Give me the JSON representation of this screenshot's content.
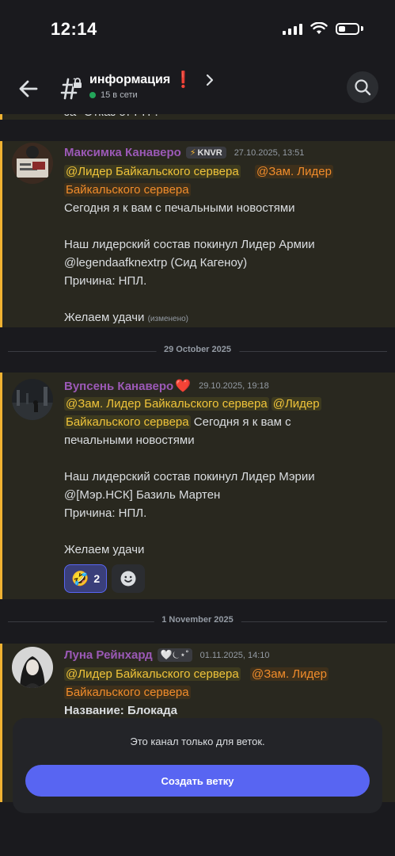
{
  "status": {
    "time": "12:14"
  },
  "header": {
    "channel_title": "информация",
    "title_emoji": "❗",
    "online": "15 в сети"
  },
  "messages": [
    {
      "author": "Максимка Канаверо",
      "tag": "KNVR",
      "timestamp": "27.10.2025, 13:51",
      "mention1": "@Лидер Байкальского сервера",
      "mention2a": "@Зам. Лидер",
      "mention2b": "Байкальского сервера",
      "line1": "Сегодня я к вам с печальными новостями",
      "line2": "Наш лидерский состав покинул Лидер Армии",
      "line3": "@legendaafknextrp (Сид Кагеноу)",
      "line4": "Причина: НПЛ.",
      "line5": "Желаем удачи",
      "edited": "(изменено)"
    },
    {
      "author": "Вупсень Канаверо",
      "author_emoji": "❤️",
      "timestamp": "29.10.2025, 19:18",
      "mention1": "@Зам. Лидер Байкальского сервера",
      "mention2a": "@Лидер",
      "mention2b": "Байкальского сервера",
      "line1a": "Сегодня я к вам с",
      "line1b": "печальными новостями",
      "line2": "Наш лидерский состав покинул Лидер Мэрии",
      "line3": "@[Мэр.НСК] Базиль Мартен",
      "line4": "Причина: НПЛ.",
      "line5": "Желаем удачи",
      "reaction_emoji": "🤣",
      "reaction_count": "2"
    },
    {
      "author": "Луна Рейнхард",
      "author_badge": "🤍⏾⋆˚",
      "timestamp": "01.11.2025, 14:10",
      "mention1": "@Лидер Байкальского сервера",
      "mention2a": "@Зам. Лидер",
      "mention2b": "Байкальского сервера",
      "line1": "Название: Блокада"
    }
  ],
  "dividers": [
    "29 October 2025",
    "1 November 2025"
  ],
  "cutoff_text": "за \"Отказ от РП\".",
  "sheet": {
    "text": "Это канал только для веток.",
    "button": "Создать ветку"
  },
  "colors": {
    "accent": "#5865f2",
    "highlight_bar": "#f0b232",
    "author": "#9b59b6",
    "online": "#23a55a"
  }
}
